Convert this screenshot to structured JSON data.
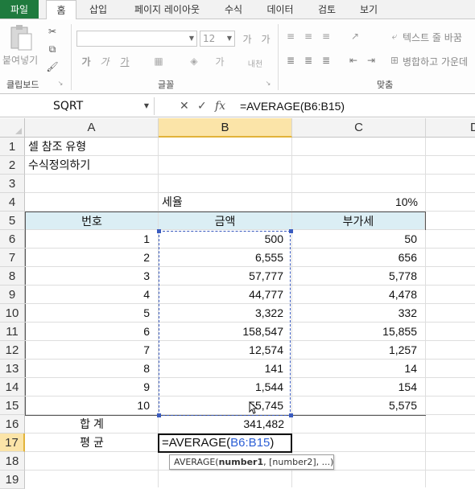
{
  "ribbon_tabs": [
    "파일",
    "홈",
    "삽입",
    "페이지 레이아웃",
    "수식",
    "데이터",
    "검토",
    "보기"
  ],
  "ribbon": {
    "clipboard": {
      "paste_label": "붙여넣기",
      "group_label": "클립보드"
    },
    "font": {
      "font_name": "",
      "font_size": "12",
      "group_label": "글꼴"
    },
    "alignment": {
      "wrap_text": "텍스트 줄 바꿈",
      "merge_center": "병합하고 가운데",
      "group_label": "맞춤"
    }
  },
  "formula_bar": {
    "name_box": "SQRT",
    "cancel": "✕",
    "enter": "✓",
    "fx": "fx",
    "formula": "=AVERAGE(B6:B15)"
  },
  "columns": [
    "A",
    "B",
    "C",
    "D"
  ],
  "rows": [
    "1",
    "2",
    "3",
    "4",
    "5",
    "6",
    "7",
    "8",
    "9",
    "10",
    "11",
    "12",
    "13",
    "14",
    "15",
    "16",
    "17",
    "18",
    "19"
  ],
  "sheet": {
    "a1": "셀 참조 유형",
    "a2": "수식정의하기",
    "b4": "세율",
    "c4": "10%",
    "headers": [
      "번호",
      "금액",
      "부가세"
    ],
    "table": [
      [
        "1",
        "500",
        "50"
      ],
      [
        "2",
        "6,555",
        "656"
      ],
      [
        "3",
        "57,777",
        "5,778"
      ],
      [
        "4",
        "44,777",
        "4,478"
      ],
      [
        "5",
        "3,322",
        "332"
      ],
      [
        "6",
        "158,547",
        "15,855"
      ],
      [
        "7",
        "12,574",
        "1,257"
      ],
      [
        "8",
        "141",
        "14"
      ],
      [
        "9",
        "1,544",
        "154"
      ],
      [
        "10",
        "55,745",
        "5,575"
      ]
    ],
    "total_label": "합  계",
    "total_value": "341,482",
    "avg_label": "평  균",
    "edit_prefix": "=AVERAGE(",
    "edit_ref": "B6:B15",
    "edit_suffix": ")"
  },
  "tooltip": {
    "fn": "AVERAGE(",
    "arg1": "number1",
    "rest": ", [number2], ...)"
  },
  "colors": {
    "file_tab": "#1f7a3e",
    "header_fill": "#dbeef4",
    "selected_header": "#fbe4a8",
    "ref_blue": "#2c5fd5"
  }
}
